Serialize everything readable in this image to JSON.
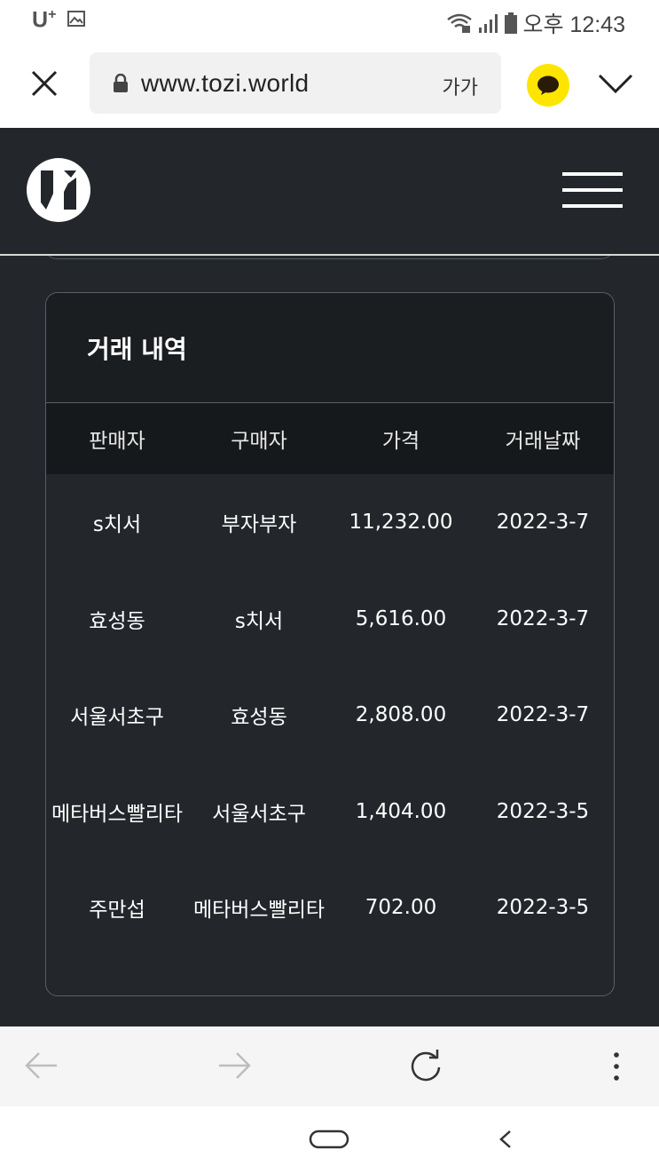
{
  "status_bar": {
    "carrier": "U",
    "carrier_sup": "+",
    "time": "오후 12:43"
  },
  "browser": {
    "url": "www.tozi.world",
    "text_size_label": "가가"
  },
  "card": {
    "title": "거래 내역",
    "columns": [
      "판매자",
      "구매자",
      "가격",
      "거래날짜"
    ],
    "rows": [
      [
        "s치서",
        "부자부자",
        "11,232.00",
        "2022-3-7"
      ],
      [
        "효성동",
        "s치서",
        "5,616.00",
        "2022-3-7"
      ],
      [
        "서울서초구",
        "효성동",
        "2,808.00",
        "2022-3-7"
      ],
      [
        "메타버스빨리타",
        "서울서초구",
        "1,404.00",
        "2022-3-5"
      ],
      [
        "주만섭",
        "메타버스빨리타",
        "702.00",
        "2022-3-5"
      ]
    ]
  },
  "colors": {
    "background": "#23272b",
    "card_header": "#1b1e21",
    "table_header": "#16191b",
    "kakao": "#fde500"
  }
}
